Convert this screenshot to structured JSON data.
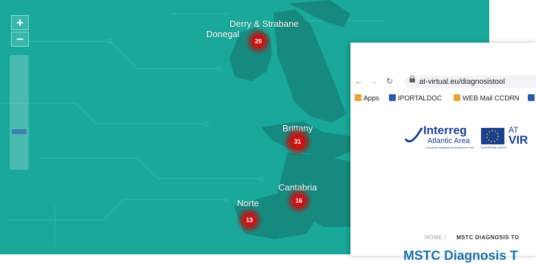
{
  "map": {
    "zoom_in_label": "+",
    "zoom_out_label": "−",
    "regions": [
      {
        "name": "Derry & Strabane",
        "count": null
      },
      {
        "name": "Donegal",
        "count": "20"
      },
      {
        "name": "Brittany",
        "count": "31"
      },
      {
        "name": "Cantabria",
        "count": "16"
      },
      {
        "name": "Norte",
        "count": "13"
      }
    ],
    "colors": {
      "sea": "#19a899",
      "land": "#178a80",
      "cluster": "#c61515"
    }
  },
  "browser": {
    "url": "at-virtual.eu/diagnosistool",
    "bookmarks": [
      "Apps",
      "IPORTALDOC",
      "WEB Mail CCDRN"
    ],
    "logo": {
      "interreg": "Interreg",
      "area": "Atlantic Area",
      "tag": "European Regional Development Fund",
      "eu": "EUROPEAN UNION",
      "at": "AT",
      "virtual": "VIR"
    },
    "breadcrumb": {
      "home": "HOME /",
      "current": "MSTC DIAGNOSIS TO"
    },
    "page_title": "MSTC Diagnosis T"
  }
}
